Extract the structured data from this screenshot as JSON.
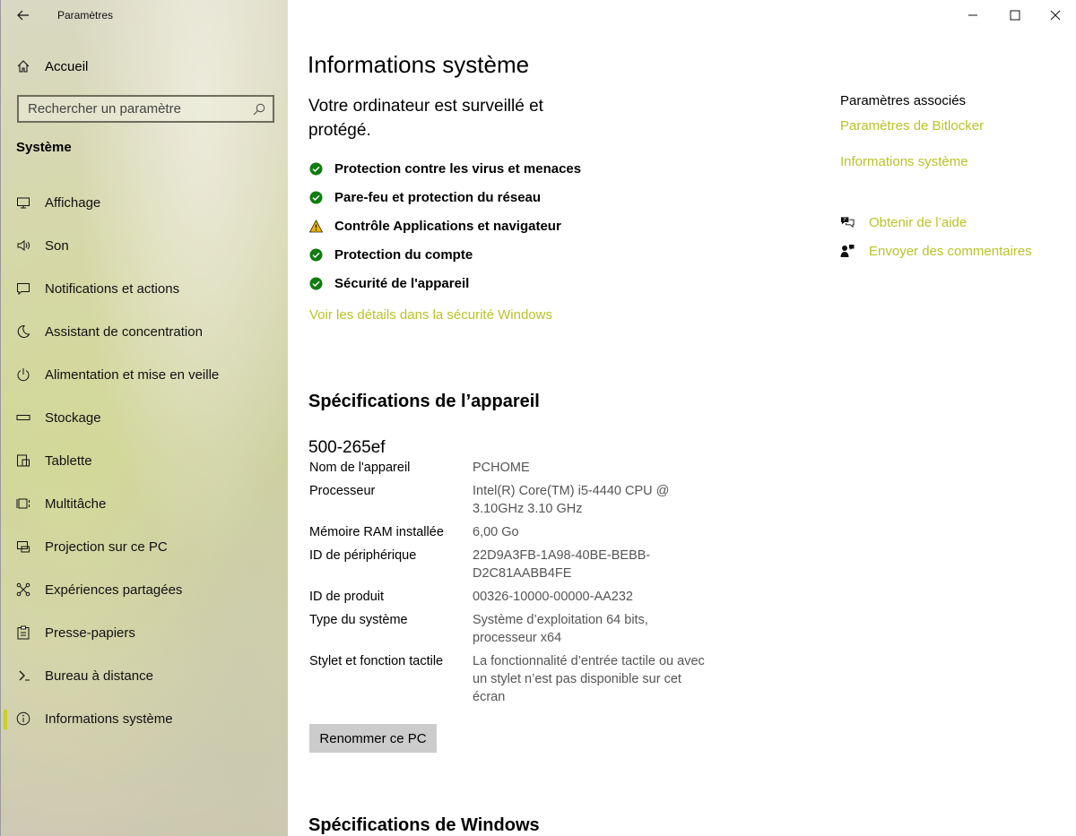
{
  "window": {
    "app_title": "Paramètres"
  },
  "sidebar": {
    "home_label": "Accueil",
    "search_placeholder": "Rechercher un paramètre",
    "section_title": "Système",
    "items": [
      {
        "label": "Affichage",
        "icon": "monitor-icon"
      },
      {
        "label": "Son",
        "icon": "speaker-icon"
      },
      {
        "label": "Notifications et actions",
        "icon": "notification-icon"
      },
      {
        "label": "Assistant de concentration",
        "icon": "moon-icon"
      },
      {
        "label": "Alimentation et mise en veille",
        "icon": "power-icon"
      },
      {
        "label": "Stockage",
        "icon": "storage-icon"
      },
      {
        "label": "Tablette",
        "icon": "tablet-icon"
      },
      {
        "label": "Multitâche",
        "icon": "multitask-icon"
      },
      {
        "label": "Projection sur ce PC",
        "icon": "projection-icon"
      },
      {
        "label": "Expériences partagées",
        "icon": "shared-icon"
      },
      {
        "label": "Presse-papiers",
        "icon": "clipboard-icon"
      },
      {
        "label": "Bureau à distance",
        "icon": "remote-desktop-icon"
      },
      {
        "label": "Informations système",
        "icon": "info-icon",
        "active": true
      }
    ]
  },
  "main": {
    "title": "Informations système",
    "protection_heading": "Votre ordinateur est surveillé et protégé.",
    "protection_items": [
      {
        "label": "Protection contre les virus et menaces",
        "status": "ok"
      },
      {
        "label": "Pare-feu et protection du réseau",
        "status": "ok"
      },
      {
        "label": "Contrôle Applications et navigateur",
        "status": "warning"
      },
      {
        "label": "Protection du compte",
        "status": "ok"
      },
      {
        "label": "Sécurité de l'appareil",
        "status": "ok"
      }
    ],
    "details_link": "Voir les détails dans la sécurité Windows",
    "device_spec_heading": "Spécifications de l’appareil",
    "device_model": "500-265ef",
    "specs": [
      {
        "key": "Nom de l'appareil",
        "value": "PCHOME"
      },
      {
        "key": "Processeur",
        "value": "Intel(R) Core(TM) i5-4440 CPU @ 3.10GHz   3.10 GHz"
      },
      {
        "key": "Mémoire RAM installée",
        "value": "6,00 Go"
      },
      {
        "key": "ID de périphérique",
        "value": "22D9A3FB-1A98-40BE-BEBB-D2C81AABB4FE"
      },
      {
        "key": "ID de produit",
        "value": "00326-10000-00000-AA232"
      },
      {
        "key": "Type du système",
        "value": "Système d’exploitation 64 bits, processeur x64"
      },
      {
        "key": "Stylet et fonction tactile",
        "value": "La fonctionnalité d’entrée tactile ou avec un stylet n’est pas disponible sur cet écran"
      }
    ],
    "rename_button": "Renommer ce PC",
    "windows_spec_heading": "Spécifications de Windows"
  },
  "related": {
    "title": "Paramètres associés",
    "links": [
      "Paramètres de Bitlocker",
      "Informations système"
    ],
    "help_label": "Obtenir de l’aide",
    "feedback_label": "Envoyer des commentaires"
  },
  "colors": {
    "accent": "#b8c426",
    "ok_status": "#107c10",
    "warning_status": "#f0b400"
  }
}
